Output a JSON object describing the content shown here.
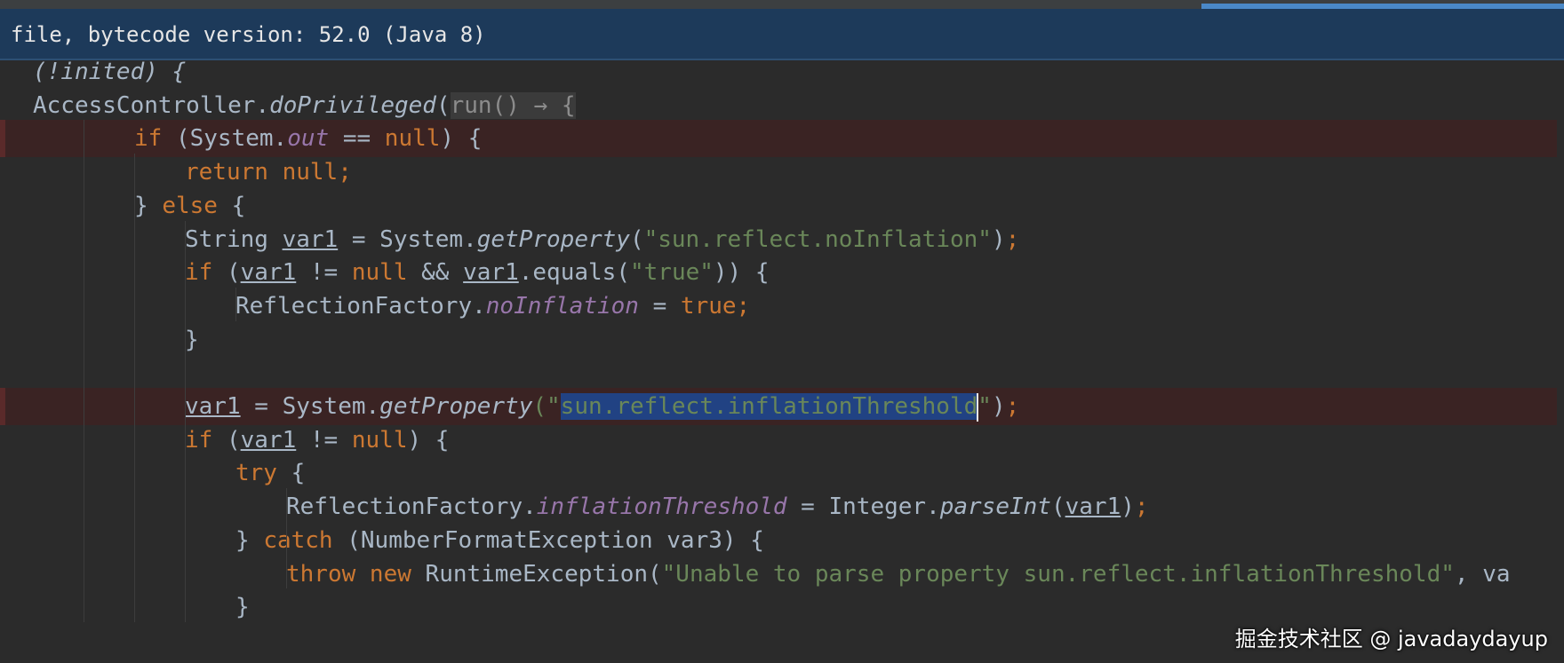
{
  "banner": {
    "text": "file, bytecode version: 52.0 (Java 8)"
  },
  "colors": {
    "default": "#a9b7c6",
    "keyword": "#cc7832",
    "string": "#6a8759",
    "static_field": "#9876aa",
    "method_italic": "#a9b7c6",
    "selection": "#214283",
    "breakpoint_line": "#3a2323",
    "banner_bg": "#1d3a5a"
  },
  "editor": {
    "lines": [
      {
        "indent": 0,
        "bp": false,
        "tokens": [
          {
            "t": "(!inited) {",
            "c": "partial"
          }
        ]
      },
      {
        "indent": 0,
        "bp": false,
        "tokens": [
          {
            "t": "AccessController.",
            "c": "default"
          },
          {
            "t": "doPrivileged",
            "c": "italic"
          },
          {
            "t": "(",
            "c": "default"
          },
          {
            "t": "run() → {",
            "c": "hint"
          }
        ]
      },
      {
        "indent": 2,
        "bp": true,
        "tokens": [
          {
            "t": "if",
            "c": "keyword"
          },
          {
            "t": " (System.",
            "c": "default"
          },
          {
            "t": "out",
            "c": "field"
          },
          {
            "t": " == ",
            "c": "default"
          },
          {
            "t": "null",
            "c": "keyword"
          },
          {
            "t": ") {",
            "c": "default"
          }
        ]
      },
      {
        "indent": 3,
        "bp": false,
        "tokens": [
          {
            "t": "return null",
            "c": "keyword"
          },
          {
            "t": ";",
            "c": "keyword"
          }
        ]
      },
      {
        "indent": 2,
        "bp": false,
        "tokens": [
          {
            "t": "} ",
            "c": "default"
          },
          {
            "t": "else",
            "c": "keyword"
          },
          {
            "t": " {",
            "c": "default"
          }
        ]
      },
      {
        "indent": 3,
        "bp": false,
        "tokens": [
          {
            "t": "String ",
            "c": "default"
          },
          {
            "t": "var1",
            "c": "underline"
          },
          {
            "t": " = System.",
            "c": "default"
          },
          {
            "t": "getProperty",
            "c": "italic"
          },
          {
            "t": "(",
            "c": "default"
          },
          {
            "t": "\"sun.reflect.noInflation\"",
            "c": "string"
          },
          {
            "t": ")",
            "c": "default"
          },
          {
            "t": ";",
            "c": "keyword"
          }
        ]
      },
      {
        "indent": 3,
        "bp": false,
        "tokens": [
          {
            "t": "if",
            "c": "keyword"
          },
          {
            "t": " (",
            "c": "default"
          },
          {
            "t": "var1",
            "c": "underline"
          },
          {
            "t": " != ",
            "c": "default"
          },
          {
            "t": "null",
            "c": "keyword"
          },
          {
            "t": " && ",
            "c": "default"
          },
          {
            "t": "var1",
            "c": "underline"
          },
          {
            "t": ".equals(",
            "c": "default"
          },
          {
            "t": "\"true\"",
            "c": "string"
          },
          {
            "t": ")) {",
            "c": "default"
          }
        ]
      },
      {
        "indent": 4,
        "bp": false,
        "tokens": [
          {
            "t": "ReflectionFactory.",
            "c": "default"
          },
          {
            "t": "noInflation",
            "c": "field"
          },
          {
            "t": " = ",
            "c": "default"
          },
          {
            "t": "true",
            "c": "keyword"
          },
          {
            "t": ";",
            "c": "keyword"
          }
        ]
      },
      {
        "indent": 3,
        "bp": false,
        "tokens": [
          {
            "t": "}",
            "c": "default"
          }
        ]
      },
      {
        "indent": 0,
        "bp": false,
        "tokens": []
      },
      {
        "indent": 3,
        "bp": true,
        "tokens": [
          {
            "t": "var1",
            "c": "underline"
          },
          {
            "t": " = System.",
            "c": "default"
          },
          {
            "t": "getProperty",
            "c": "italic"
          },
          {
            "t": "(\"",
            "c": "string"
          },
          {
            "t": "sun.reflect.inflationThreshold",
            "c": "selected"
          },
          {
            "t": "|",
            "c": "caret"
          },
          {
            "t": "\"",
            "c": "string"
          },
          {
            "t": ")",
            "c": "default"
          },
          {
            "t": ";",
            "c": "keyword"
          }
        ]
      },
      {
        "indent": 3,
        "bp": false,
        "tokens": [
          {
            "t": "if",
            "c": "keyword"
          },
          {
            "t": " (",
            "c": "default"
          },
          {
            "t": "var1",
            "c": "underline"
          },
          {
            "t": " != ",
            "c": "default"
          },
          {
            "t": "null",
            "c": "keyword"
          },
          {
            "t": ") {",
            "c": "default"
          }
        ]
      },
      {
        "indent": 4,
        "bp": false,
        "tokens": [
          {
            "t": "try",
            "c": "keyword"
          },
          {
            "t": " {",
            "c": "default"
          }
        ]
      },
      {
        "indent": 5,
        "bp": false,
        "tokens": [
          {
            "t": "ReflectionFactory.",
            "c": "default"
          },
          {
            "t": "inflationThreshold",
            "c": "field"
          },
          {
            "t": " = Integer.",
            "c": "default"
          },
          {
            "t": "parseInt",
            "c": "italic"
          },
          {
            "t": "(",
            "c": "default"
          },
          {
            "t": "var1",
            "c": "underline"
          },
          {
            "t": ")",
            "c": "default"
          },
          {
            "t": ";",
            "c": "keyword"
          }
        ]
      },
      {
        "indent": 4,
        "bp": false,
        "tokens": [
          {
            "t": "} ",
            "c": "default"
          },
          {
            "t": "catch",
            "c": "keyword"
          },
          {
            "t": " (NumberFormatException var3) {",
            "c": "default"
          }
        ]
      },
      {
        "indent": 5,
        "bp": false,
        "tokens": [
          {
            "t": "throw new",
            "c": "keyword"
          },
          {
            "t": " RuntimeException(",
            "c": "default"
          },
          {
            "t": "\"Unable to parse property sun.reflect.inflationThreshold\"",
            "c": "string"
          },
          {
            "t": ", va",
            "c": "default"
          }
        ]
      },
      {
        "indent": 4,
        "bp": false,
        "tokens": [
          {
            "t": "}",
            "c": "default"
          }
        ]
      }
    ]
  },
  "watermark": {
    "text": "掘金技术社区 @ javadaydayup"
  }
}
